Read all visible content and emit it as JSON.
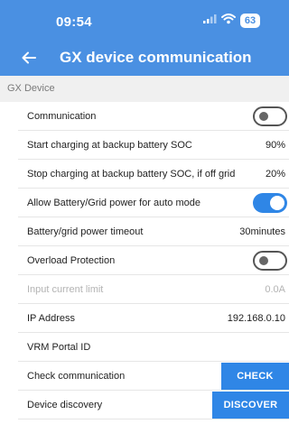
{
  "status_bar": {
    "time": "09:54",
    "battery": "63",
    "icons": [
      "signal-icon",
      "wifi-icon",
      "battery-icon"
    ]
  },
  "app_bar": {
    "back_icon": "arrow-left-icon",
    "title": "GX device communication"
  },
  "section": {
    "header": "GX Device"
  },
  "rows": {
    "communication": {
      "label": "Communication",
      "toggle": "off"
    },
    "start_charging": {
      "label": "Start charging at backup battery SOC",
      "value": "90%"
    },
    "stop_charging": {
      "label": "Stop charging at backup battery SOC, if off grid",
      "value": "20%"
    },
    "allow_power": {
      "label": "Allow Battery/Grid power for auto mode",
      "toggle": "on"
    },
    "timeout": {
      "label": "Battery/grid power timeout",
      "value": "30minutes"
    },
    "overload": {
      "label": "Overload Protection",
      "toggle": "off"
    },
    "input_limit": {
      "label": "Input current limit",
      "value": "0.0A",
      "disabled": true
    },
    "ip_address": {
      "label": "IP Address",
      "value": "192.168.0.10"
    },
    "vrm_portal": {
      "label": "VRM Portal ID",
      "value": ""
    },
    "check_comm": {
      "label": "Check communication",
      "button": "CHECK"
    },
    "discovery": {
      "label": "Device discovery",
      "button": "DISCOVER"
    }
  },
  "colors": {
    "primary": "#4a90e2",
    "accent": "#2f86e6",
    "section_bg": "#f0f0f0",
    "disabled_text": "#b3b3b3"
  }
}
